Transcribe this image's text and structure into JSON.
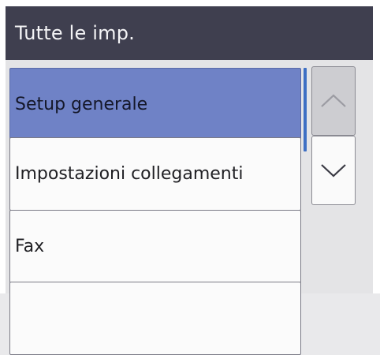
{
  "header": {
    "title": "Tutte le imp."
  },
  "menu": {
    "items": [
      {
        "label": "Setup generale",
        "selected": true
      },
      {
        "label": "Impostazioni collegamenti",
        "selected": false
      },
      {
        "label": "Fax",
        "selected": false
      },
      {
        "label": "",
        "selected": false
      }
    ]
  },
  "scroll": {
    "up_icon": "chevron-up-icon",
    "down_icon": "chevron-down-icon",
    "up_enabled": false,
    "down_enabled": true
  },
  "colors": {
    "title_bar": "#3f3f4f",
    "selected_item": "#6f82c6",
    "scroll_thumb": "#3d6fc4"
  }
}
